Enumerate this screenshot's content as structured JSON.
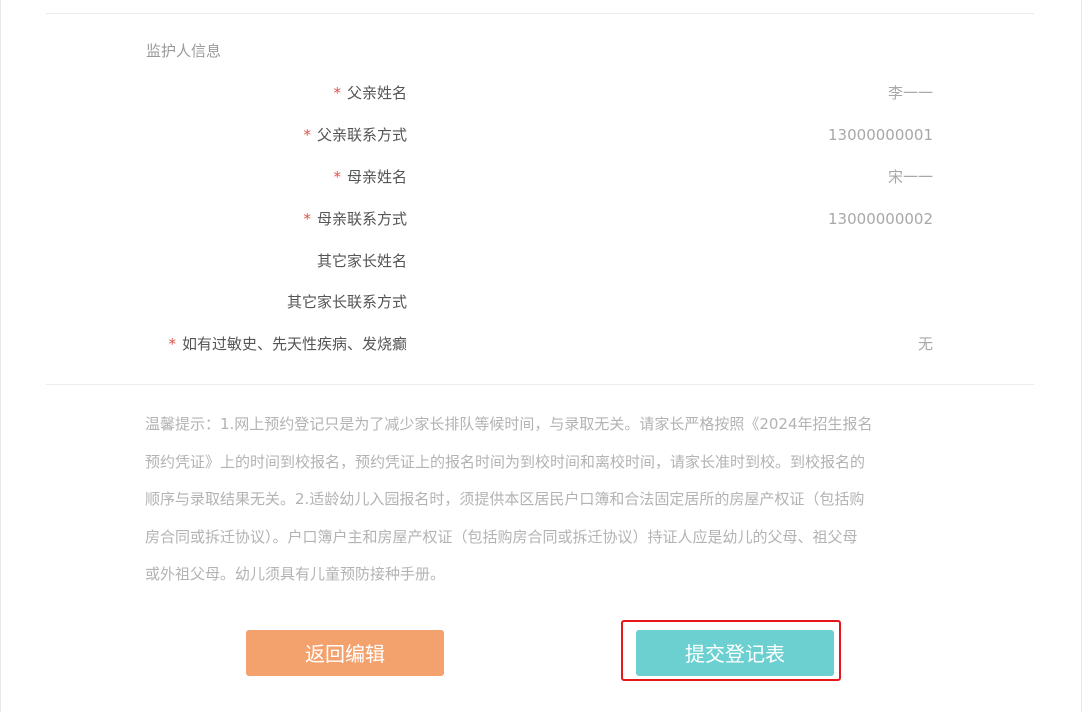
{
  "section": {
    "title": "监护人信息"
  },
  "fields": [
    {
      "label": "父亲姓名",
      "required": true,
      "value": "李一一"
    },
    {
      "label": "父亲联系方式",
      "required": true,
      "value": "13000000001"
    },
    {
      "label": "母亲姓名",
      "required": true,
      "value": "宋一一"
    },
    {
      "label": "母亲联系方式",
      "required": true,
      "value": "13000000002"
    },
    {
      "label": "其它家长姓名",
      "required": false,
      "value": ""
    },
    {
      "label": "其它家长联系方式",
      "required": false,
      "value": ""
    },
    {
      "label": "如有过敏史、先天性疾病、发烧癫",
      "required": true,
      "value": "无"
    }
  ],
  "notice": {
    "lines": [
      "温馨提示：1.网上预约登记只是为了减少家长排队等候时间，与录取无关。请家长严格按照《2024年招生报名",
      "预约凭证》上的时间到校报名，预约凭证上的报名时间为到校时间和离校时间，请家长准时到校。到校报名的",
      "顺序与录取结果无关。2.适龄幼儿入园报名时，须提供本区居民户口簿和合法固定居所的房屋产权证（包括购",
      "房合同或拆迁协议）。户口簿户主和房屋产权证（包括购房合同或拆迁协议）持证人应是幼儿的父母、祖父母",
      "或外祖父母。幼儿须具有儿童预防接种手册。"
    ]
  },
  "buttons": {
    "back_label": "返回编辑",
    "submit_label": "提交登记表"
  },
  "colors": {
    "required_star": "#e0534a",
    "back_button": "#f3a26e",
    "submit_button": "#6cd0d0",
    "highlight_border": "#e5171b"
  }
}
